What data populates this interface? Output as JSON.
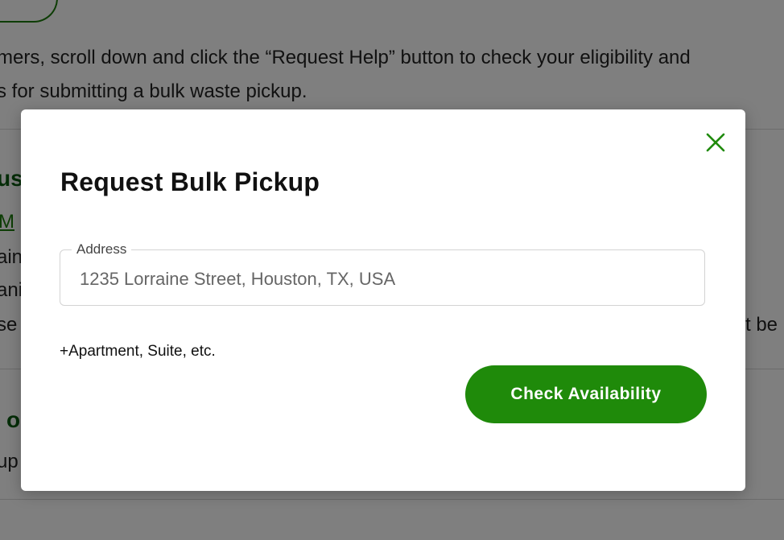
{
  "background": {
    "line1": "mers, scroll down and click the “Request Help” button to check your eligibility and",
    "line2": "s for submitting a bulk waste pickup.",
    "frag_heading_a": "us",
    "frag_link": "M",
    "frag_ain": "ain",
    "frag_ani": "ani",
    "frag_se": "se",
    "frag_tbe": "t be",
    "frag_heading_b": "o",
    "frag_up": "up"
  },
  "modal": {
    "title": "Request Bulk Pickup",
    "close_icon": "close-icon",
    "address": {
      "label": "Address",
      "value": "1235 Lorraine Street, Houston, TX, USA"
    },
    "apartment_link": "+Apartment, Suite, etc.",
    "check_button": "Check Availability"
  },
  "colors": {
    "accent": "#1f8a0a",
    "overlay": "rgba(0,0,0,0.5)"
  }
}
